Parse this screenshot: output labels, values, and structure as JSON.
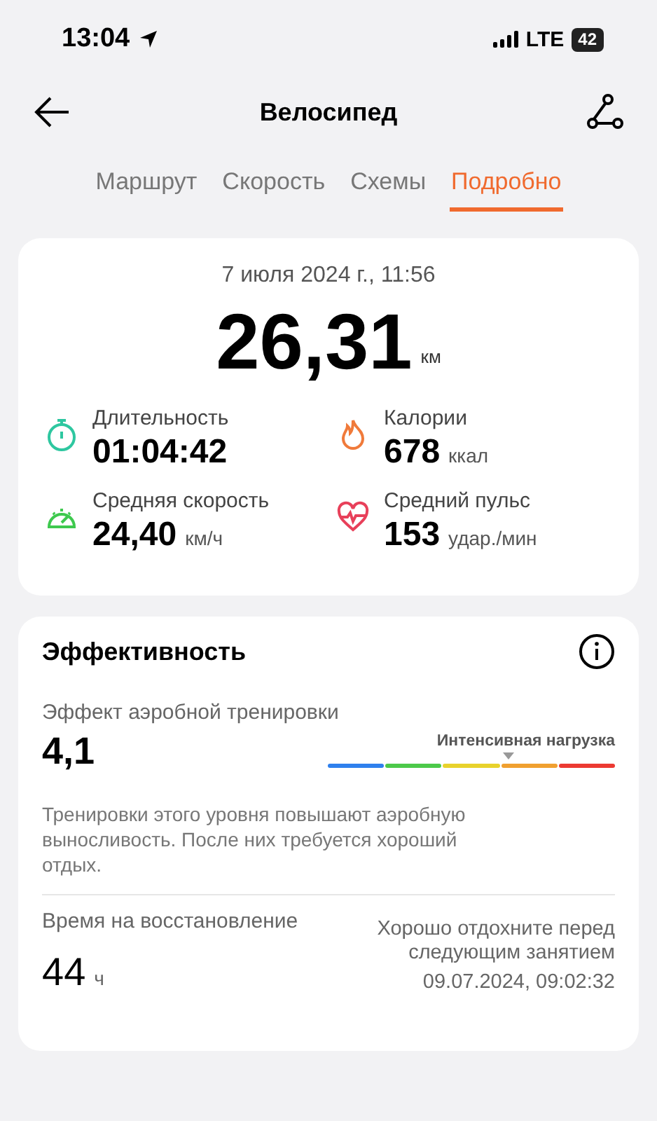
{
  "status_bar": {
    "time": "13:04",
    "network": "LTE",
    "battery": "42"
  },
  "header": {
    "title": "Велосипед"
  },
  "tabs": [
    {
      "label": "Маршрут",
      "selected": false
    },
    {
      "label": "Скорость",
      "selected": false
    },
    {
      "label": "Схемы",
      "selected": false
    },
    {
      "label": "Подробно",
      "selected": true
    }
  ],
  "summary": {
    "date": "7 июля 2024 г., 11:56",
    "distance": "26,31",
    "distance_unit": "км",
    "stats": [
      {
        "kind": "timer",
        "color": "#2ec7a0",
        "label": "Длительность",
        "value": "01:04:42"
      },
      {
        "kind": "flame",
        "color": "#f07a3a",
        "label": "Калории",
        "value": "678",
        "unit": "ккал"
      },
      {
        "kind": "speed",
        "color": "#3ec94e",
        "label": "Средняя скорость",
        "value": "24,40",
        "unit": "км/ч"
      },
      {
        "kind": "heart",
        "color": "#e8405a",
        "label": "Средний пульс",
        "value": "153",
        "unit": "удар./мин"
      }
    ]
  },
  "efficiency": {
    "title": "Эффективность",
    "aerobic_label": "Эффект аэробной тренировки",
    "aerobic_value": "4,1",
    "scale_label": "Интенсивная нагрузка",
    "level": 0.63,
    "scale": [
      {
        "color": "#2f80ed"
      },
      {
        "color": "#4cc94a"
      },
      {
        "color": "#e8d22c"
      },
      {
        "color": "#f0a030"
      },
      {
        "color": "#ec3a32"
      }
    ],
    "description": "Тренировки этого уровня повышают аэробную выносливость. После них требуется хороший отдых.",
    "recovery_label": "Время на восстановление",
    "recovery_value": "44",
    "recovery_unit": "ч",
    "recovery_note": "Хорошо отдохните перед следующим занятием",
    "recovery_until": "09.07.2024, 09:02:32"
  }
}
